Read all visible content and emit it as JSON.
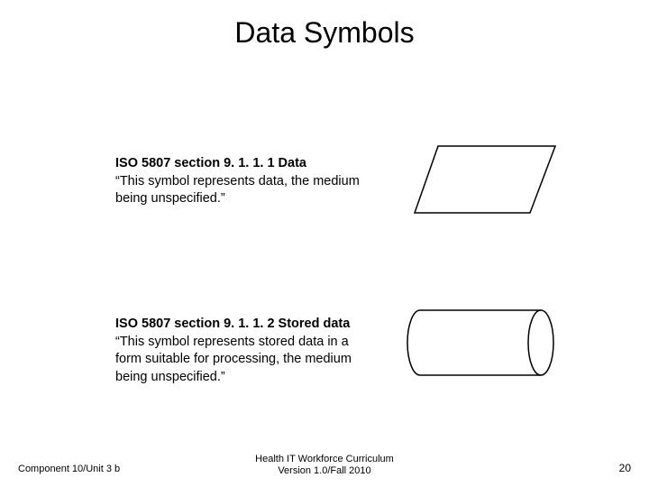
{
  "title": "Data Symbols",
  "sections": [
    {
      "heading": "ISO 5807 section 9. 1. 1. 1 Data",
      "desc": "“This symbol represents data, the medium being unspecified.”"
    },
    {
      "heading": "ISO 5807 section 9. 1. 1. 2 Stored data",
      "desc_cont": " “This symbol represents stored data in a form suitable for processing, the medium being unspecified.”"
    }
  ],
  "footer": {
    "left": "Component 10/Unit 3 b",
    "center_line1": "Health IT Workforce Curriculum",
    "center_line2": "Version 1.0/Fall 2010",
    "right": "20"
  }
}
